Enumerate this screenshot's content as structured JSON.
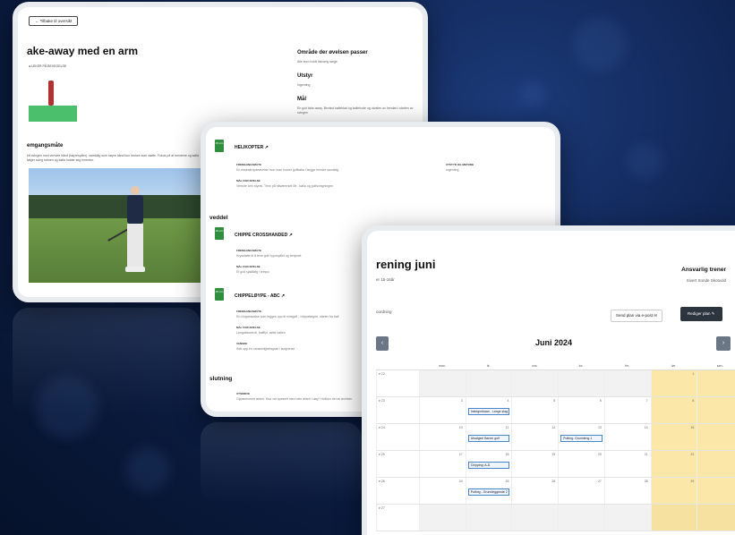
{
  "exercise_detail": {
    "back_label": "← Tilbake til oversikt",
    "title": "ake-away med en arm",
    "author": "LEKER PÅ BEVEGELSE",
    "section_title": "emgangsmåte",
    "section_text": "ett svingen med venstre hånd (høyrespiller), samtidig som høyre hånd kun brukes som støtte. Fokus på at hendene og kølla følger sving rutinen og kølla holder seg innenfor.",
    "right_col": [
      {
        "heading": "Område der øvelsen passer",
        "text": "Alle som holdt tilsvarig range"
      },
      {
        "heading": "Utstyr",
        "text": "Ingenting"
      },
      {
        "heading": "Mål",
        "text": "En god take-away. Bevisst kølleblad og køllehode og utvalen av hendan i starten av svingen"
      }
    ]
  },
  "exercise_list": {
    "items": [
      {
        "title": "HELIKOPTER",
        "badge": "15 min",
        "l1": "FREMGANGSMÅTE",
        "t1": "En ekstrakropseøvelse hvor man holder golfkølla i begge hender samtidig",
        "l2": "MÅL FOR ØVELSE",
        "t2": "Venstre arm styres. Trinn på nåværende lår - kølla og golfsvingningen",
        "l3": "UTSTYR OG METODE",
        "t3": "Ingenting"
      },
      {
        "title": "CHIPPE CROSSHANDED",
        "badge": "15 min",
        "l1": "FREMGANGSMÅTE",
        "t1": "Kryssfatte til å tene golf hypospillet og tempoet",
        "l2": "MÅL FOR ØVELSE",
        "t2": "Et god sjaldfølg i tempo",
        "l3": "",
        "t3": ""
      },
      {
        "title": "CHIPPELØYPE - ABC",
        "badge": "15 min",
        "l1": "FREMGANGSMÅTE",
        "t1": "En chippeøvelse som legges opp til minigolf - chippeløyper, starter fra ball",
        "l2": "MÅL FOR ØVELSE",
        "t2": "Lengdekontroll, ballflyt, sette ballen",
        "l3": "VANSKE",
        "t3": "Sett opp en vanskelighetsgrad i ledgrense"
      }
    ],
    "sections": [
      "veddel",
      "slutning"
    ],
    "closing_label": "UTSKRIVE",
    "closing_text": "Oppsummere økten. Hva var spesielt med hele økten i dag? Hvilken del av øvelsen"
  },
  "plan": {
    "title": "rening juni",
    "subtitle": "er 15-16år",
    "trainer_heading": "Ansvarlig trener",
    "trainer_name": "Sivert Sonde Skotvold",
    "coordination_label": "oordning",
    "send_button": "Send plan via e-post ✉",
    "edit_button": "Rediger plan ✎",
    "prev": "‹",
    "next": "›",
    "month": "Juni 2024",
    "weekdays": [
      "",
      "man.",
      "tir.",
      "ons.",
      "tor.",
      "fre.",
      "lør.",
      "søn."
    ],
    "weeks": [
      {
        "week": "e 22",
        "days": [
          "",
          "",
          "",
          "",
          "",
          "1",
          "2"
        ],
        "events": [
          "",
          "",
          "",
          "",
          "",
          "",
          ""
        ]
      },
      {
        "week": "e 23",
        "days": [
          "3",
          "4",
          "5",
          "6",
          "7",
          "8",
          "9"
        ],
        "events": [
          "",
          "Instegnekaan - Lange slag",
          "",
          "",
          "",
          "",
          ""
        ]
      },
      {
        "week": "e 24",
        "days": [
          "10",
          "11",
          "12",
          "13",
          "14",
          "15",
          "16"
        ],
        "events": [
          "",
          "Utsalgsel Banen golf",
          "",
          "Putting: Grunnleng 1",
          "",
          "",
          ""
        ]
      },
      {
        "week": "e 25",
        "days": [
          "17",
          "18",
          "19",
          "20",
          "21",
          "22",
          "23"
        ],
        "events": [
          "",
          "Chipping: A-Å",
          "",
          "",
          "",
          "",
          ""
        ]
      },
      {
        "week": "e 26",
        "days": [
          "24",
          "25",
          "26",
          "27",
          "28",
          "29",
          "30"
        ],
        "events": [
          "",
          "Putting - Grunnleggende 2",
          "",
          "",
          "",
          "",
          ""
        ]
      },
      {
        "week": "e 27",
        "days": [
          "",
          "",
          "",
          "",
          "",
          "",
          ""
        ],
        "events": [
          "",
          "",
          "",
          "",
          "",
          "",
          ""
        ]
      }
    ]
  }
}
